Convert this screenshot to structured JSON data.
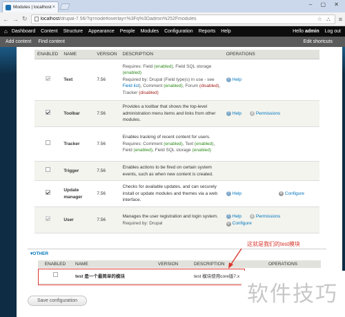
{
  "browser": {
    "tab_title": "Modules | localhost",
    "tab_close": "×",
    "url_host": "localhost",
    "url_rest": "/drupal-7.56/?q=node#overlay=%3Fq%3Dadmin%252Fmodules",
    "window_controls": "– ▢ ✕",
    "url_tools": "☆ ⛬"
  },
  "toolbar": {
    "items": [
      "Dashboard",
      "Content",
      "Structure",
      "Appearance",
      "People",
      "Modules",
      "Configuration",
      "Reports",
      "Help"
    ],
    "hello_prefix": "Hello ",
    "user": "admin",
    "logout": "Log out"
  },
  "shortcuts": {
    "items": [
      "Add content",
      "Find content"
    ],
    "edit": "Edit shortcuts"
  },
  "table": {
    "headers": {
      "enabled": "ENABLED",
      "name": "NAME",
      "version": "VERSION",
      "description": "DESCRIPTION",
      "operations": "OPERATIONS"
    },
    "rows": [
      {
        "name": "Text",
        "version": "7.56",
        "desc": "",
        "requires_label": "Requires:",
        "requires": "Field (enabled), Field SQL storage (enabled)",
        "requiredby_label": "Required by:",
        "requiredby": "Drupal (Field type(s) in use - see Field list), Comment (enabled), Forum (disabled), Tracker (disabled)",
        "ops": [
          "Help"
        ]
      },
      {
        "name": "Toolbar",
        "version": "7.56",
        "desc": "Provides a toolbar that shows the top-level administration menu items and links from other modules.",
        "ops": [
          "Help",
          "Permissions"
        ]
      },
      {
        "name": "Tracker",
        "version": "7.56",
        "desc": "Enables tracking of recent content for users.",
        "requires_label": "Requires:",
        "requires": "Comment (enabled), Text (enabled), Field (enabled), Field SQL storage (enabled)",
        "ops": []
      },
      {
        "name": "Trigger",
        "version": "7.56",
        "desc": "Enables actions to be fired on certain system events, such as when new content is created.",
        "ops": []
      },
      {
        "name": "Update manager",
        "version": "7.56",
        "desc": "Checks for available updates, and can securely install or update modules and themes via a web interface.",
        "ops": [
          "Help",
          "Configure"
        ]
      },
      {
        "name": "User",
        "version": "7.56",
        "desc": "Manages the user registration and login system.",
        "requiredby_label": "Required by:",
        "requiredby": "Drupal",
        "ops": [
          "Help",
          "Permissions",
          "Configure"
        ]
      }
    ]
  },
  "other": {
    "legend": "OTHER",
    "headers": {
      "enabled": "ENABLED",
      "name": "NAME",
      "version": "VERSION",
      "description": "DESCRIPTION",
      "operations": "OPERATIONS"
    },
    "row": {
      "name": "test 是一个最简单的模块",
      "desc": "test 模块使用core版7.x"
    }
  },
  "annotation": "这就是我们的test模块",
  "watermark": "软件技巧",
  "save_button": "Save configuration",
  "colors": {
    "annotation": "#d9372e",
    "link": "#0074bd",
    "enabled": "#2f8b1c",
    "disabled": "#a3231c"
  }
}
